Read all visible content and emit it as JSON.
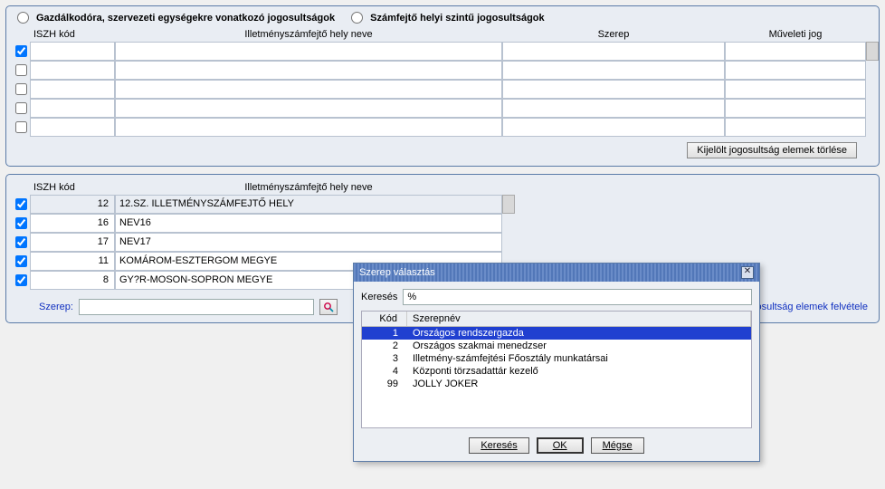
{
  "radios": {
    "opt1": "Gazdálkodóra, szervezeti egységekre vonatkozó jogosultságok",
    "opt2": "Számfejtő helyi szintű jogosultságok"
  },
  "top_headers": {
    "iszh": "ISZH kód",
    "hely": "Illetményszámfejtő hely neve",
    "szerep": "Szerep",
    "muv": "Műveleti jog"
  },
  "top_rows": [
    {
      "checked": true
    },
    {
      "checked": false
    },
    {
      "checked": false
    },
    {
      "checked": false
    },
    {
      "checked": false
    }
  ],
  "top_delete_btn": "Kijelölt jogosultság elemek törlése",
  "bot_headers": {
    "iszh": "ISZH kód",
    "hely": "Illetményszámfejtő hely neve"
  },
  "bot_rows": [
    {
      "checked": true,
      "kod": "12",
      "hely": "12.SZ. ILLETMÉNYSZÁMFEJTŐ HELY",
      "selected": true
    },
    {
      "checked": true,
      "kod": "16",
      "hely": "NEV16"
    },
    {
      "checked": true,
      "kod": "17",
      "hely": "NEV17"
    },
    {
      "checked": true,
      "kod": "11",
      "hely": "KOMÁROM-ESZTERGOM MEGYE"
    },
    {
      "checked": true,
      "kod": "8",
      "hely": "GY?R-MOSON-SOPRON MEGYE"
    }
  ],
  "bottom": {
    "szerep_label": "Szerep:",
    "add_link": "jogosultság elemek felvétele"
  },
  "dialog": {
    "title": "Szerep választás",
    "search_label": "Keresés",
    "search_value": "%",
    "list_hdr_kod": "Kód",
    "list_hdr_nev": "Szerepnév",
    "rows": [
      {
        "kod": "1",
        "nev": "Országos rendszergazda",
        "sel": true
      },
      {
        "kod": "2",
        "nev": "Országos szakmai menedzser"
      },
      {
        "kod": "3",
        "nev": "Illetmény-számfejtési Főosztály munkatársai"
      },
      {
        "kod": "4",
        "nev": "Központi törzsadattár kezelő"
      },
      {
        "kod": "99",
        "nev": "JOLLY JOKER"
      }
    ],
    "btn_search": "Keresés",
    "btn_ok": "OK",
    "btn_cancel": "Mégse"
  }
}
